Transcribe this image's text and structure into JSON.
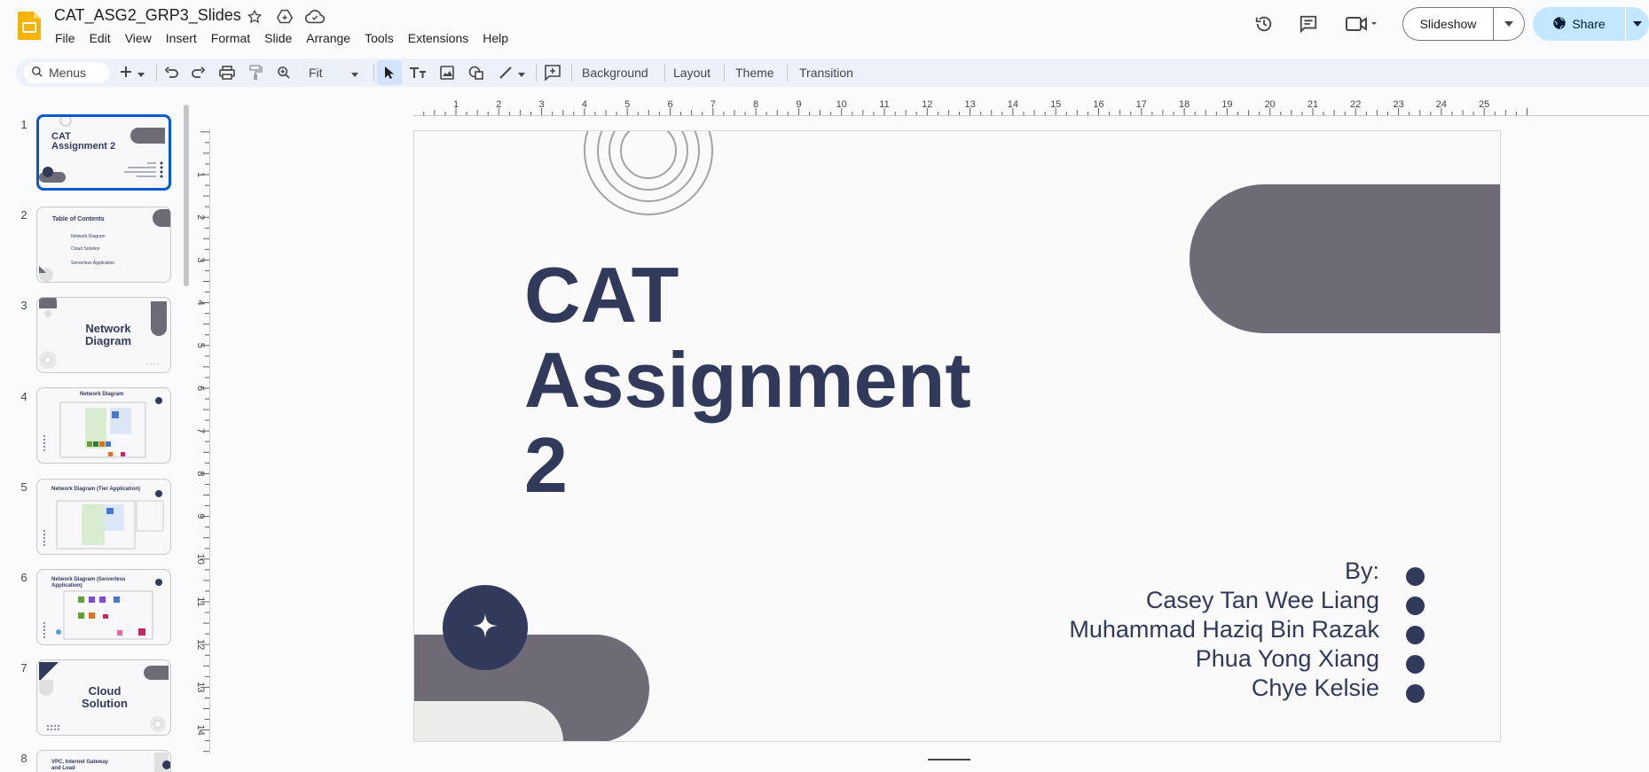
{
  "app": {
    "doc_title": "CAT_ASG2_GRP3_Slides",
    "menu": [
      "File",
      "Edit",
      "View",
      "Insert",
      "Format",
      "Slide",
      "Arrange",
      "Tools",
      "Extensions",
      "Help"
    ],
    "slideshow_label": "Slideshow",
    "share_label": "Share"
  },
  "toolbar": {
    "search_label": "Menus",
    "zoom_value": "Fit",
    "background_label": "Background",
    "layout_label": "Layout",
    "theme_label": "Theme",
    "transition_label": "Transition"
  },
  "thumbnails": [
    {
      "number": "1",
      "title": "CAT Assignment 2"
    },
    {
      "number": "2",
      "title": "Table of Contents",
      "items": [
        "Network Diagram",
        "Cloud Solution",
        "Serverless Application"
      ]
    },
    {
      "number": "3",
      "title": "Network Diagram"
    },
    {
      "number": "4",
      "title": "Network Diagram"
    },
    {
      "number": "5",
      "title": "Network Diagram (Tier Application)"
    },
    {
      "number": "6",
      "title": "Network Diagram (Serverless Application)"
    },
    {
      "number": "7",
      "title": "Cloud Solution"
    },
    {
      "number": "8",
      "title": "VPC, Internet Gateway and Load"
    }
  ],
  "ruler": {
    "top_ticks": [
      "1",
      "2",
      "3",
      "4",
      "5",
      "6",
      "7",
      "8",
      "9",
      "10",
      "11",
      "12",
      "13",
      "14",
      "15",
      "16",
      "17",
      "18",
      "19",
      "20",
      "21",
      "22",
      "23",
      "24",
      "25"
    ],
    "left_ticks": [
      "1",
      "2",
      "3",
      "4",
      "5",
      "6",
      "7",
      "8",
      "9",
      "10",
      "11",
      "12",
      "13",
      "14"
    ]
  },
  "slide": {
    "title": "CAT\nAssignment\n2",
    "authors": [
      "By:",
      "Casey Tan Wee Liang",
      "Muhammad Haziq Bin Razak",
      "Phua Yong Xiang",
      "Chye Kelsie"
    ]
  },
  "colors": {
    "navy": "#323a5c",
    "gray_shape": "#6e6b77",
    "light_shape": "#ececea",
    "accent_blue": "#0b57d0"
  }
}
